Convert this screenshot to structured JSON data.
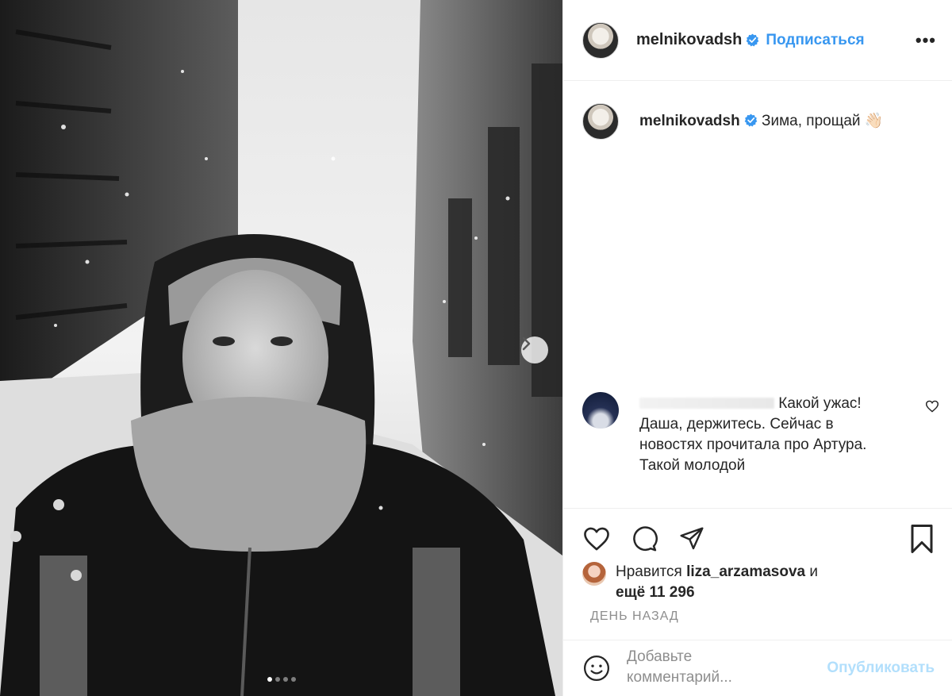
{
  "post": {
    "author": "melnikovadsh",
    "follow_label": "Подписаться",
    "more_label": "•••",
    "caption": {
      "username": "melnikovadsh",
      "text": "Зима, прощай 👋🏻"
    },
    "comments": [
      {
        "text": "Какой ужас! Даша, держитесь. Сейчас в новостях прочитала про Артура. Такой молодой"
      }
    ],
    "likes": {
      "prefix": "Нравится",
      "username": "liza_arzamasova",
      "suffix": "и",
      "others": "ещё 11 296"
    },
    "timestamp": "ДЕНЬ НАЗАД",
    "add_comment": {
      "placeholder": "Добавьте комментарий...",
      "publish_label": "Опубликовать"
    },
    "carousel": {
      "current": 1,
      "total": 4
    }
  },
  "colors": {
    "accent": "#3897f0",
    "publish_disabled": "#b2dffc",
    "muted": "#8e8e8e",
    "text": "#262626"
  },
  "icons": [
    "verified-icon",
    "chevron-right-icon",
    "heart-icon",
    "comment-icon",
    "share-icon",
    "bookmark-icon",
    "smile-icon",
    "more-icon"
  ]
}
